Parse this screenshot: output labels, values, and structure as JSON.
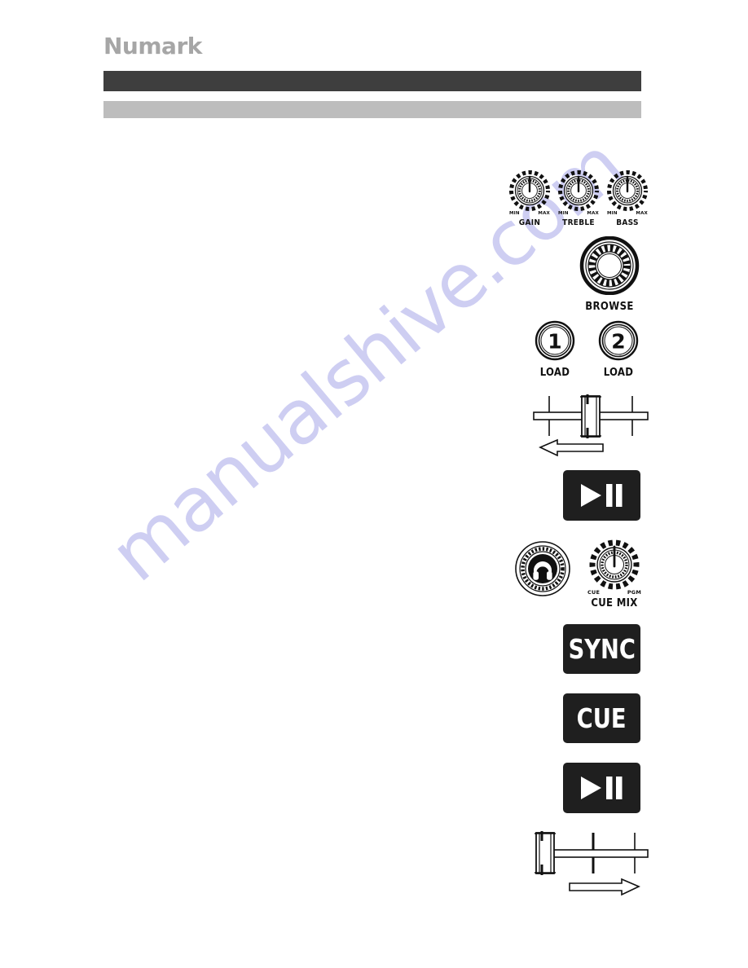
{
  "page": {
    "brand": "Numark",
    "watermark": "manualshive.com"
  },
  "header": {
    "dark_bar_color": "#3e3e3e",
    "gray_bar_color": "#bdbdbd"
  },
  "controls": {
    "knobs": [
      {
        "label": "GAIN",
        "min": "MIN",
        "max": "MAX"
      },
      {
        "label": "TREBLE",
        "min": "MIN",
        "max": "MAX"
      },
      {
        "label": "BASS",
        "min": "MIN",
        "max": "MAX"
      }
    ],
    "browse": {
      "label": "BROWSE"
    },
    "load_buttons": [
      {
        "number": "1",
        "label": "LOAD"
      },
      {
        "number": "2",
        "label": "LOAD"
      }
    ],
    "crossfader_top": {
      "position": "center",
      "arrow": "left"
    },
    "crossfader_bottom": {
      "position": "left",
      "arrow": "right"
    },
    "play_pause_1": {
      "icon": "play-pause-icon"
    },
    "headphone_knob": {
      "icon": "headphone-icon"
    },
    "cue_mix": {
      "label": "CUE MIX",
      "min": "CUE",
      "max": "PGM"
    },
    "sync_button": {
      "label": "SYNC"
    },
    "cue_button": {
      "label": "CUE"
    },
    "play_pause_2": {
      "icon": "play-pause-icon"
    }
  }
}
